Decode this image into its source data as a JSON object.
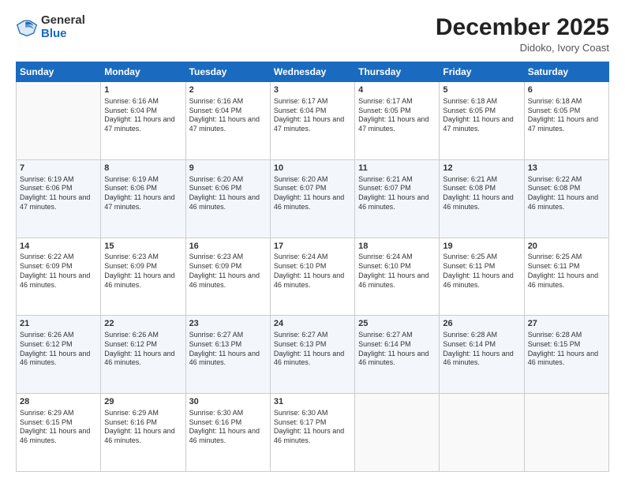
{
  "header": {
    "logo_general": "General",
    "logo_blue": "Blue",
    "month_title": "December 2025",
    "location": "Didoko, Ivory Coast"
  },
  "days_of_week": [
    "Sunday",
    "Monday",
    "Tuesday",
    "Wednesday",
    "Thursday",
    "Friday",
    "Saturday"
  ],
  "weeks": [
    [
      {
        "day": "",
        "info": ""
      },
      {
        "day": "1",
        "info": "Sunrise: 6:16 AM\nSunset: 6:04 PM\nDaylight: 11 hours and 47 minutes."
      },
      {
        "day": "2",
        "info": "Sunrise: 6:16 AM\nSunset: 6:04 PM\nDaylight: 11 hours and 47 minutes."
      },
      {
        "day": "3",
        "info": "Sunrise: 6:17 AM\nSunset: 6:04 PM\nDaylight: 11 hours and 47 minutes."
      },
      {
        "day": "4",
        "info": "Sunrise: 6:17 AM\nSunset: 6:05 PM\nDaylight: 11 hours and 47 minutes."
      },
      {
        "day": "5",
        "info": "Sunrise: 6:18 AM\nSunset: 6:05 PM\nDaylight: 11 hours and 47 minutes."
      },
      {
        "day": "6",
        "info": "Sunrise: 6:18 AM\nSunset: 6:05 PM\nDaylight: 11 hours and 47 minutes."
      }
    ],
    [
      {
        "day": "7",
        "info": "Sunrise: 6:19 AM\nSunset: 6:06 PM\nDaylight: 11 hours and 47 minutes."
      },
      {
        "day": "8",
        "info": "Sunrise: 6:19 AM\nSunset: 6:06 PM\nDaylight: 11 hours and 47 minutes."
      },
      {
        "day": "9",
        "info": "Sunrise: 6:20 AM\nSunset: 6:06 PM\nDaylight: 11 hours and 46 minutes."
      },
      {
        "day": "10",
        "info": "Sunrise: 6:20 AM\nSunset: 6:07 PM\nDaylight: 11 hours and 46 minutes."
      },
      {
        "day": "11",
        "info": "Sunrise: 6:21 AM\nSunset: 6:07 PM\nDaylight: 11 hours and 46 minutes."
      },
      {
        "day": "12",
        "info": "Sunrise: 6:21 AM\nSunset: 6:08 PM\nDaylight: 11 hours and 46 minutes."
      },
      {
        "day": "13",
        "info": "Sunrise: 6:22 AM\nSunset: 6:08 PM\nDaylight: 11 hours and 46 minutes."
      }
    ],
    [
      {
        "day": "14",
        "info": "Sunrise: 6:22 AM\nSunset: 6:09 PM\nDaylight: 11 hours and 46 minutes."
      },
      {
        "day": "15",
        "info": "Sunrise: 6:23 AM\nSunset: 6:09 PM\nDaylight: 11 hours and 46 minutes."
      },
      {
        "day": "16",
        "info": "Sunrise: 6:23 AM\nSunset: 6:09 PM\nDaylight: 11 hours and 46 minutes."
      },
      {
        "day": "17",
        "info": "Sunrise: 6:24 AM\nSunset: 6:10 PM\nDaylight: 11 hours and 46 minutes."
      },
      {
        "day": "18",
        "info": "Sunrise: 6:24 AM\nSunset: 6:10 PM\nDaylight: 11 hours and 46 minutes."
      },
      {
        "day": "19",
        "info": "Sunrise: 6:25 AM\nSunset: 6:11 PM\nDaylight: 11 hours and 46 minutes."
      },
      {
        "day": "20",
        "info": "Sunrise: 6:25 AM\nSunset: 6:11 PM\nDaylight: 11 hours and 46 minutes."
      }
    ],
    [
      {
        "day": "21",
        "info": "Sunrise: 6:26 AM\nSunset: 6:12 PM\nDaylight: 11 hours and 46 minutes."
      },
      {
        "day": "22",
        "info": "Sunrise: 6:26 AM\nSunset: 6:12 PM\nDaylight: 11 hours and 46 minutes."
      },
      {
        "day": "23",
        "info": "Sunrise: 6:27 AM\nSunset: 6:13 PM\nDaylight: 11 hours and 46 minutes."
      },
      {
        "day": "24",
        "info": "Sunrise: 6:27 AM\nSunset: 6:13 PM\nDaylight: 11 hours and 46 minutes."
      },
      {
        "day": "25",
        "info": "Sunrise: 6:27 AM\nSunset: 6:14 PM\nDaylight: 11 hours and 46 minutes."
      },
      {
        "day": "26",
        "info": "Sunrise: 6:28 AM\nSunset: 6:14 PM\nDaylight: 11 hours and 46 minutes."
      },
      {
        "day": "27",
        "info": "Sunrise: 6:28 AM\nSunset: 6:15 PM\nDaylight: 11 hours and 46 minutes."
      }
    ],
    [
      {
        "day": "28",
        "info": "Sunrise: 6:29 AM\nSunset: 6:15 PM\nDaylight: 11 hours and 46 minutes."
      },
      {
        "day": "29",
        "info": "Sunrise: 6:29 AM\nSunset: 6:16 PM\nDaylight: 11 hours and 46 minutes."
      },
      {
        "day": "30",
        "info": "Sunrise: 6:30 AM\nSunset: 6:16 PM\nDaylight: 11 hours and 46 minutes."
      },
      {
        "day": "31",
        "info": "Sunrise: 6:30 AM\nSunset: 6:17 PM\nDaylight: 11 hours and 46 minutes."
      },
      {
        "day": "",
        "info": ""
      },
      {
        "day": "",
        "info": ""
      },
      {
        "day": "",
        "info": ""
      }
    ]
  ]
}
